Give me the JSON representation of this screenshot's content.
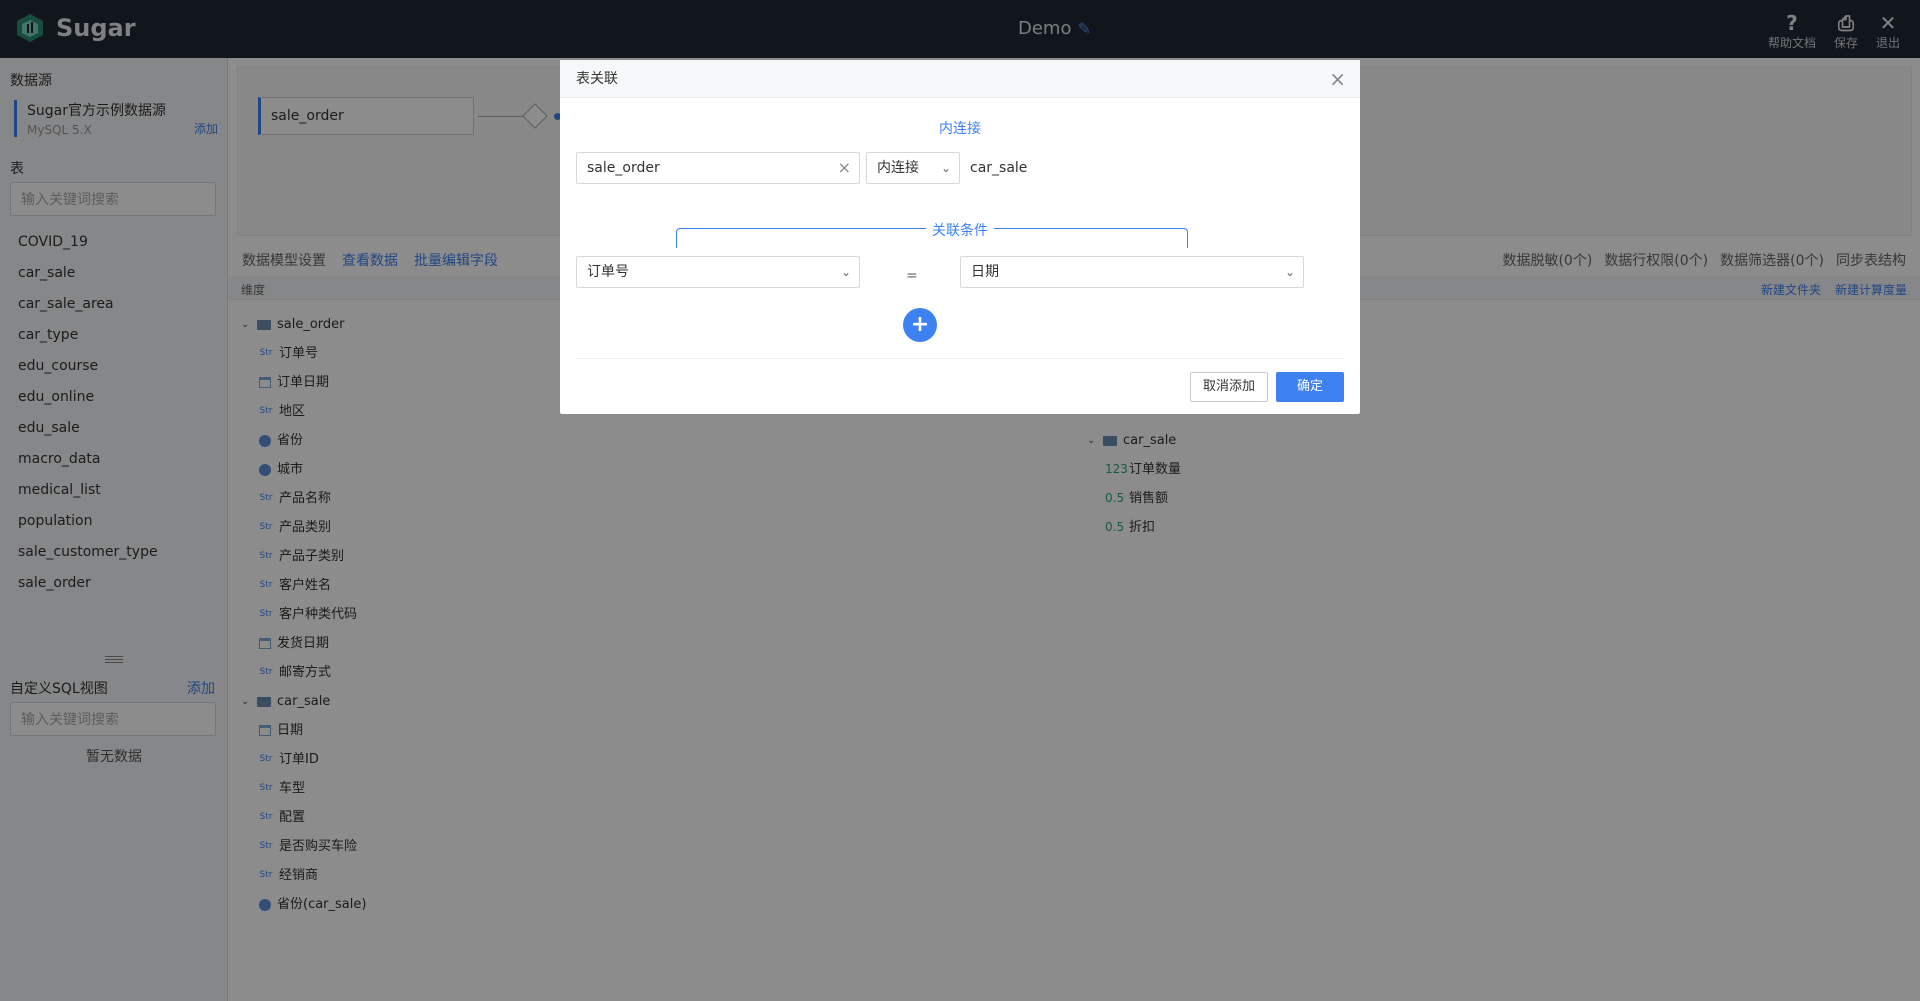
{
  "app": {
    "name": "Sugar",
    "title": "Demo"
  },
  "top_actions": [
    {
      "icon": "help-icon",
      "glyph": "?",
      "label": "帮助文档"
    },
    {
      "icon": "save-icon",
      "glyph": "⎙",
      "label": "保存"
    },
    {
      "icon": "close-icon",
      "glyph": "✕",
      "label": "退出"
    }
  ],
  "sidebar": {
    "datasource_heading": "数据源",
    "datasource_name": "Sugar官方示例数据源",
    "datasource_type": "MySQL 5.X",
    "datasource_add": "添加",
    "table_heading": "表",
    "table_search_placeholder": "输入关键词搜索",
    "tables": [
      "COVID_19",
      "car_sale",
      "car_sale_area",
      "car_type",
      "edu_course",
      "edu_online",
      "edu_sale",
      "macro_data",
      "medical_list",
      "population",
      "sale_customer_type",
      "sale_order"
    ],
    "sql_heading": "自定义SQL视图",
    "sql_add": "添加",
    "sql_search_placeholder": "输入关键词搜索",
    "sql_empty": "暂无数据"
  },
  "canvas": {
    "node": "sale_order"
  },
  "tabs": {
    "settings": "数据模型设置",
    "view_data": "查看数据",
    "batch_edit": "批量编辑字段"
  },
  "right_links": [
    "数据脱敏(0个)",
    "数据行权限(0个)",
    "数据筛选器(0个)",
    "同步表结构"
  ],
  "colbar": {
    "dimension": "维度",
    "new_folder": "新建文件夹",
    "new_measure": "新建计算度量"
  },
  "dimensions": {
    "sale_order": {
      "name": "sale_order",
      "fields": [
        {
          "type": "str",
          "label": "订单号"
        },
        {
          "type": "date",
          "label": "订单日期"
        },
        {
          "type": "str",
          "label": "地区"
        },
        {
          "type": "geo",
          "label": "省份"
        },
        {
          "type": "geo",
          "label": "城市"
        },
        {
          "type": "str",
          "label": "产品名称"
        },
        {
          "type": "str",
          "label": "产品类别"
        },
        {
          "type": "str",
          "label": "产品子类别"
        },
        {
          "type": "str",
          "label": "客户姓名"
        },
        {
          "type": "str",
          "label": "客户种类代码"
        },
        {
          "type": "date",
          "label": "发货日期"
        },
        {
          "type": "str",
          "label": "邮寄方式"
        }
      ]
    },
    "car_sale": {
      "name": "car_sale",
      "fields": [
        {
          "type": "date",
          "label": "日期"
        },
        {
          "type": "str",
          "label": "订单ID"
        },
        {
          "type": "str",
          "label": "车型"
        },
        {
          "type": "str",
          "label": "配置"
        },
        {
          "type": "str",
          "label": "是否购买车险"
        },
        {
          "type": "str",
          "label": "经销商"
        },
        {
          "type": "geo",
          "label": "省份(car_sale)"
        }
      ]
    }
  },
  "measures": {
    "car_sale": {
      "name": "car_sale",
      "fields": [
        {
          "tag": "123",
          "label": "订单数量"
        },
        {
          "tag": "0.5",
          "label": "销售额"
        },
        {
          "tag": "0.5",
          "label": "折扣"
        }
      ]
    }
  },
  "type_tags": {
    "str": "Str"
  },
  "modal": {
    "title": "表关联",
    "join_type_label": "内连接",
    "left_table": "sale_order",
    "join_select": "内连接",
    "right_table": "car_sale",
    "condition_label": "关联条件",
    "left_field": "订单号",
    "operator": "=",
    "right_field": "日期",
    "cancel": "取消添加",
    "confirm": "确定"
  },
  "colors": {
    "accent": "#3d82f0",
    "topbar": "#1f2733",
    "measure": "#2aa876"
  }
}
